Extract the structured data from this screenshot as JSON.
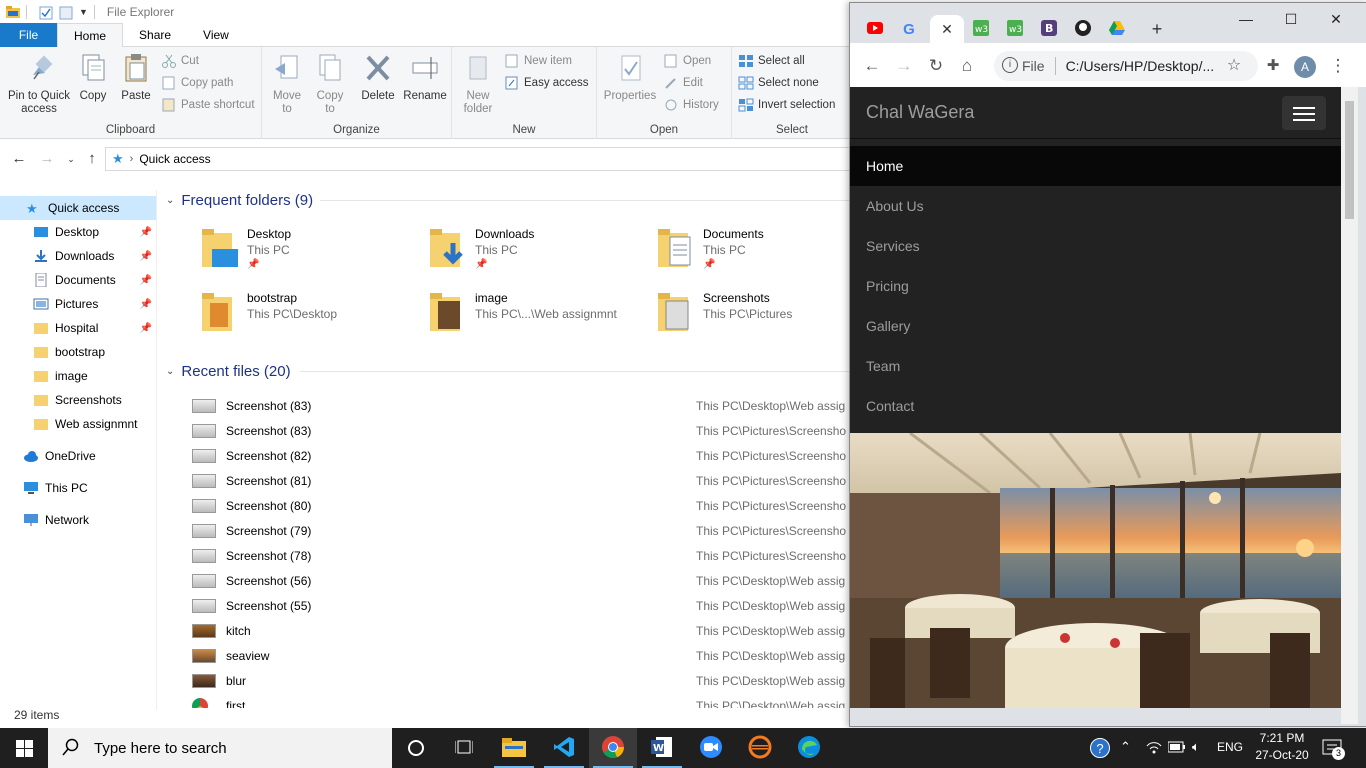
{
  "explorer": {
    "title": "File Explorer",
    "tabs": {
      "file": "File",
      "home": "Home",
      "share": "Share",
      "view": "View"
    },
    "ribbon": {
      "clipboard": {
        "label": "Clipboard",
        "pin": "Pin to Quick access",
        "copy": "Copy",
        "paste": "Paste",
        "cut": "Cut",
        "copy_path": "Copy path",
        "paste_shortcut": "Paste shortcut"
      },
      "organize": {
        "label": "Organize",
        "move_to": "Move to",
        "copy_to": "Copy to",
        "delete": "Delete",
        "rename": "Rename"
      },
      "new": {
        "label": "New",
        "new_folder": "New folder",
        "new_item": "New item",
        "easy_access": "Easy access"
      },
      "open": {
        "label": "Open",
        "properties": "Properties",
        "open": "Open",
        "edit": "Edit",
        "history": "History"
      },
      "select": {
        "label": "Select",
        "select_all": "Select all",
        "select_none": "Select none",
        "invert": "Invert selection"
      }
    },
    "address": {
      "path": "Quick access"
    },
    "nav": {
      "quick_access": "Quick access",
      "items": [
        "Desktop",
        "Downloads",
        "Documents",
        "Pictures",
        "Hospital",
        "bootstrap",
        "image",
        "Screenshots",
        "Web assignmnt"
      ],
      "onedrive": "OneDrive",
      "this_pc": "This PC",
      "network": "Network"
    },
    "frequent": {
      "heading": "Frequent folders (9)",
      "folders": [
        {
          "name": "Desktop",
          "path": "This PC"
        },
        {
          "name": "Downloads",
          "path": "This PC"
        },
        {
          "name": "Documents",
          "path": "This PC"
        },
        {
          "name": "bootstrap",
          "path": "This PC\\Desktop"
        },
        {
          "name": "image",
          "path": "This PC\\...\\Web assignmnt"
        },
        {
          "name": "Screenshots",
          "path": "This PC\\Pictures"
        }
      ]
    },
    "recent": {
      "heading": "Recent files (20)",
      "files": [
        {
          "name": "Screenshot (83)",
          "path": "This PC\\Desktop\\Web assig"
        },
        {
          "name": "Screenshot (83)",
          "path": "This PC\\Pictures\\Screensho"
        },
        {
          "name": "Screenshot (82)",
          "path": "This PC\\Pictures\\Screensho"
        },
        {
          "name": "Screenshot (81)",
          "path": "This PC\\Pictures\\Screensho"
        },
        {
          "name": "Screenshot (80)",
          "path": "This PC\\Pictures\\Screensho"
        },
        {
          "name": "Screenshot (79)",
          "path": "This PC\\Pictures\\Screensho"
        },
        {
          "name": "Screenshot (78)",
          "path": "This PC\\Pictures\\Screensho"
        },
        {
          "name": "Screenshot (56)",
          "path": "This PC\\Desktop\\Web assig"
        },
        {
          "name": "Screenshot (55)",
          "path": "This PC\\Desktop\\Web assig"
        },
        {
          "name": "kitch",
          "path": "This PC\\Desktop\\Web assig"
        },
        {
          "name": "seaview",
          "path": "This PC\\Desktop\\Web assig"
        },
        {
          "name": "blur",
          "path": "This PC\\Desktop\\Web assig"
        },
        {
          "name": "first",
          "path": "This PC\\Desktop\\Web assig"
        }
      ]
    },
    "status": "29 items"
  },
  "chrome": {
    "omnibox_scheme": "File",
    "url": "C:/Users/HP/Desktop/...",
    "avatar_letter": "A",
    "tab_icons": [
      "youtube-icon",
      "google-icon",
      "close-icon",
      "w3schools-icon",
      "w3schools-icon",
      "bootstrap-icon",
      "github-icon",
      "google-drive-icon"
    ]
  },
  "site": {
    "brand": "Chal WaGera",
    "nav": [
      "Home",
      "About Us",
      "Services",
      "Pricing",
      "Gallery",
      "Team",
      "Contact"
    ]
  },
  "taskbar": {
    "search_placeholder": "Type here to search",
    "language": "ENG",
    "time": "7:21 PM",
    "date": "27-Oct-20",
    "notifications": "3"
  },
  "colors": {
    "accent": "#1979ca",
    "selected": "#cce8ff",
    "navbar": "#222222",
    "taskbar": "#1f1f1f"
  }
}
